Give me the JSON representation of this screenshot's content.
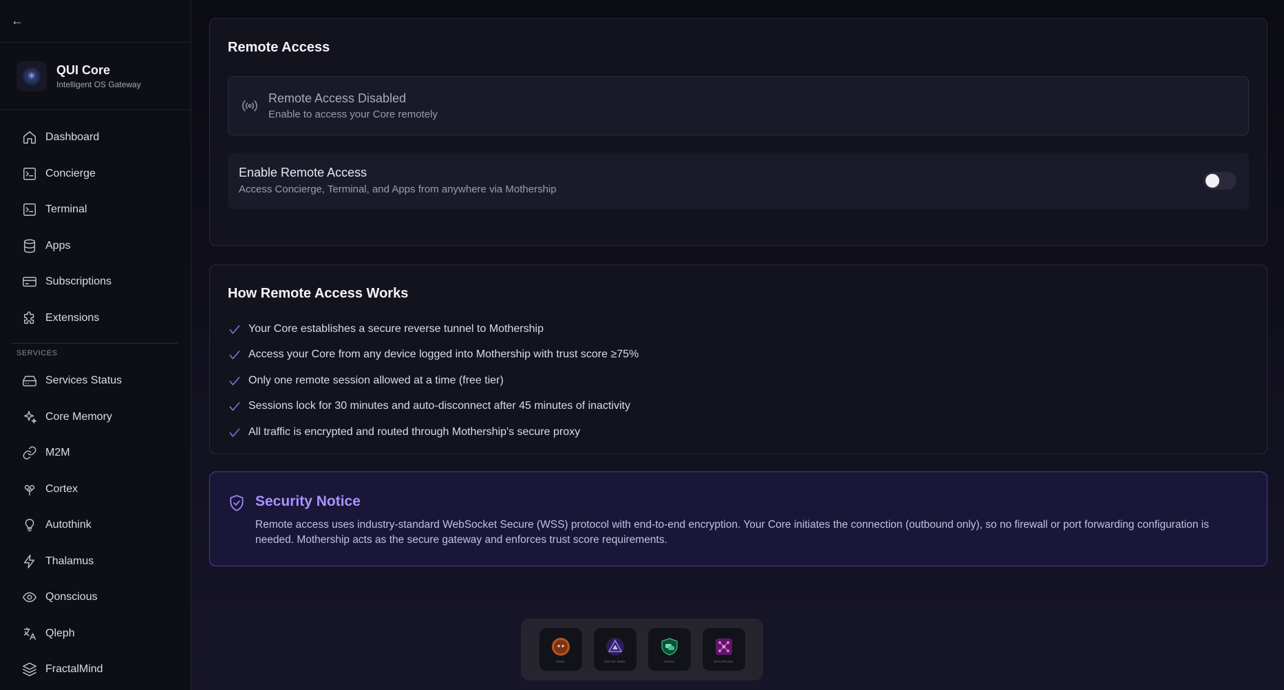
{
  "sidebar": {
    "back_icon": "arrow-left-icon",
    "brand": {
      "title": "QUI Core",
      "subtitle": "Intelligent OS Gateway"
    },
    "nav": [
      {
        "label": "Dashboard",
        "icon": "home-icon"
      },
      {
        "label": "Concierge",
        "icon": "terminal-square-icon"
      },
      {
        "label": "Terminal",
        "icon": "terminal-square-icon"
      },
      {
        "label": "Apps",
        "icon": "database-icon"
      },
      {
        "label": "Subscriptions",
        "icon": "credit-card-icon"
      },
      {
        "label": "Extensions",
        "icon": "puzzle-icon"
      }
    ],
    "services_label": "SERVICES",
    "services": [
      {
        "label": "Services Status",
        "icon": "hard-drive-icon"
      },
      {
        "label": "Core Memory",
        "icon": "sparkles-icon"
      },
      {
        "label": "M2M",
        "icon": "link-icon"
      },
      {
        "label": "Cortex",
        "icon": "brain-icon"
      },
      {
        "label": "Autothink",
        "icon": "lightbulb-icon"
      },
      {
        "label": "Thalamus",
        "icon": "zap-icon"
      },
      {
        "label": "Qonscious",
        "icon": "eye-icon"
      },
      {
        "label": "Qleph",
        "icon": "languages-icon"
      },
      {
        "label": "FractalMind",
        "icon": "layers-icon"
      }
    ]
  },
  "remote": {
    "title": "Remote Access",
    "status": {
      "title": "Remote Access Disabled",
      "subtitle": "Enable to access your Core remotely"
    },
    "toggle": {
      "title": "Enable Remote Access",
      "subtitle": "Access Concierge, Terminal, and Apps from anywhere via Mothership",
      "enabled": false
    }
  },
  "how": {
    "title": "How Remote Access Works",
    "items": [
      "Your Core establishes a secure reverse tunnel to Mothership",
      "Access your Core from any device logged into Mothership with trust score ≥75%",
      "Only one remote session allowed at a time (free tier)",
      "Sessions lock for 30 minutes and auto-disconnect after 45 minutes of inactivity",
      "All traffic is encrypted and routed through Mothership's secure proxy"
    ]
  },
  "notice": {
    "title": "Security Notice",
    "body": "Remote access uses industry-standard WebSocket Secure (WSS) protocol with end-to-end encryption. Your Core initiates the connection (outbound only), so no firewall or port forwarding configuration is needed. Mothership acts as the secure gateway and enforces trust score requirements."
  },
  "dock": {
    "apps": [
      {
        "label": "KENA"
      },
      {
        "label": "DIGITAL MIND"
      },
      {
        "label": "CHAKA"
      },
      {
        "label": "NEXUSFLOW"
      }
    ]
  },
  "colors": {
    "accent": "#8b7cf6",
    "notice_title": "#a794ff",
    "check": "#8577e6"
  }
}
